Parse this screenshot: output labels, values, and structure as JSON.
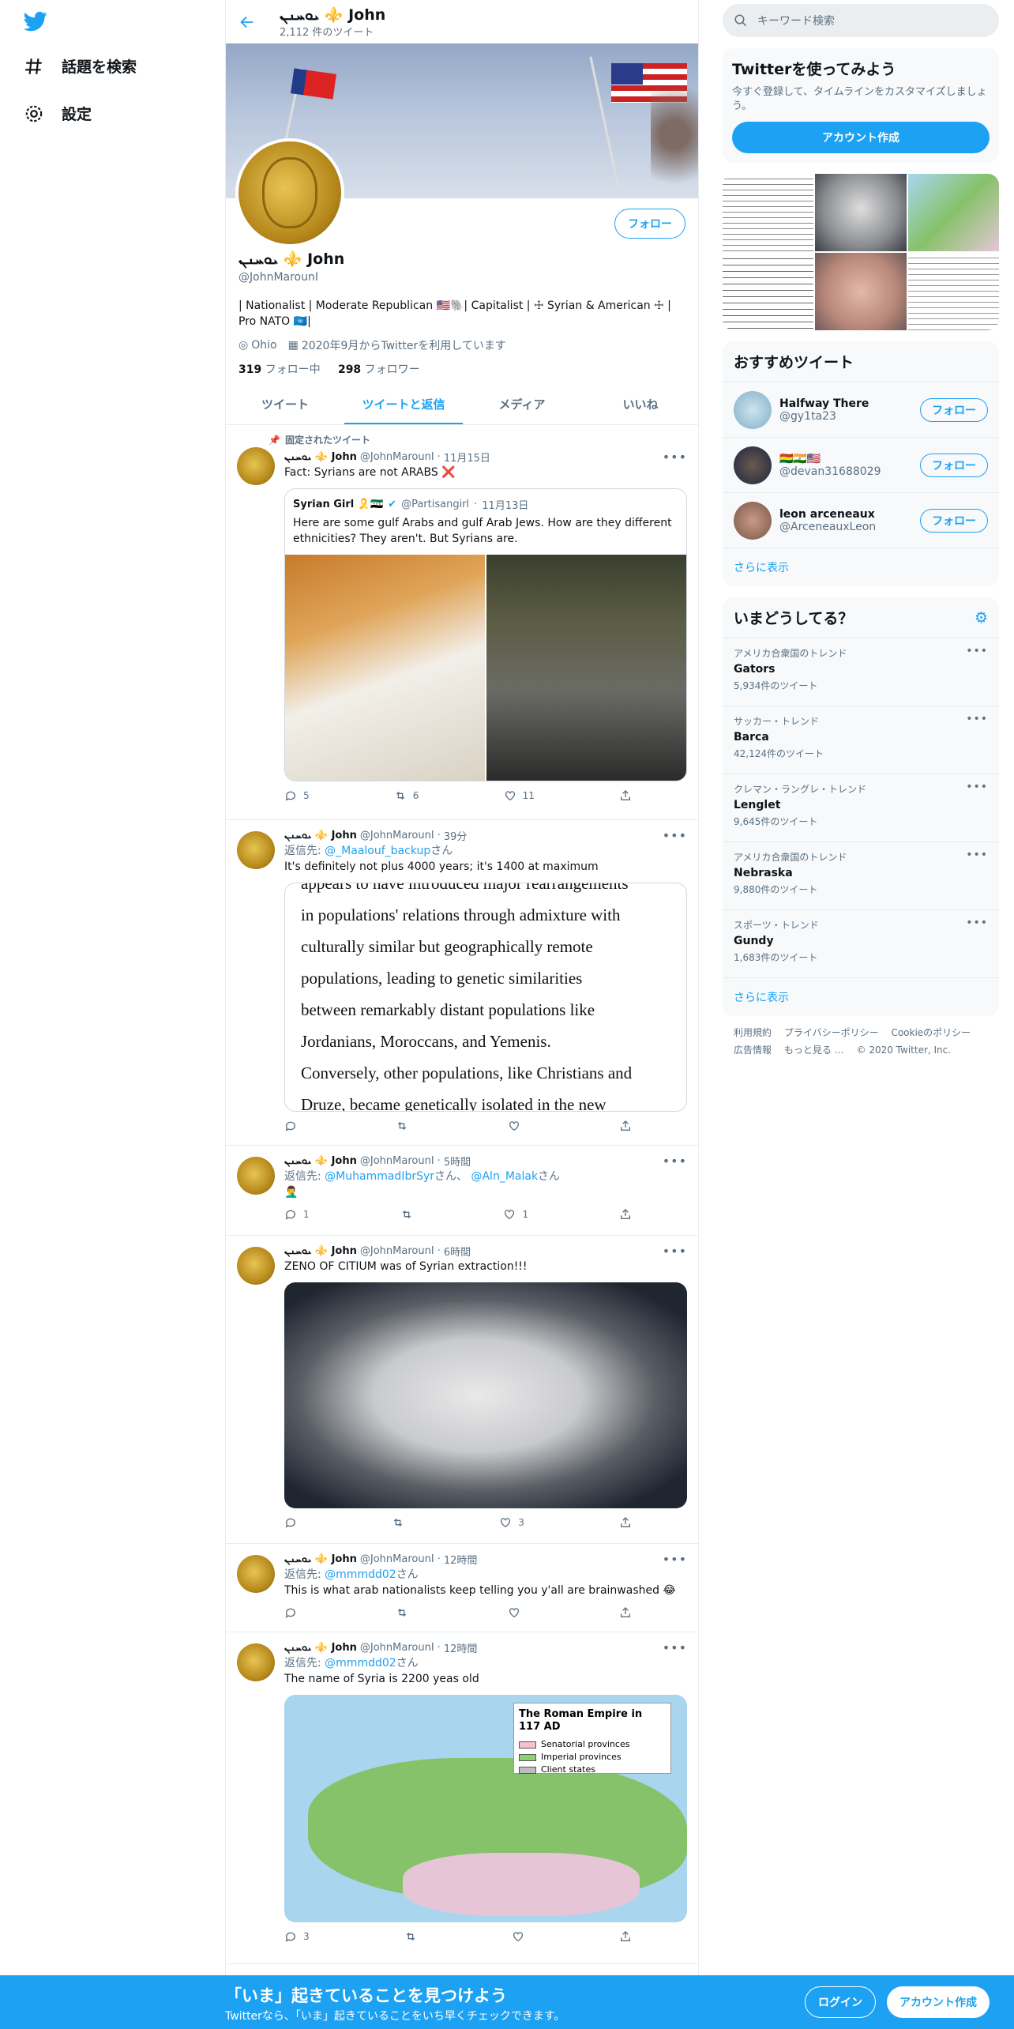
{
  "nav": {
    "explore": "話題を検索",
    "settings": "設定"
  },
  "topbar": {
    "name": "ܝܘܚܢܢ ⚜️ John",
    "tweet_count": "2,112 件のツイート"
  },
  "profile": {
    "name": "ܝܘܚܢܢ ⚜️ John",
    "handle": "@JohnMarounI",
    "bio": "| Nationalist | Moderate Republican 🇺🇸🐘| Capitalist | ☩ Syrian & American ☩ | Pro NATO 🇺🇳|",
    "location": "Ohio",
    "joined": "2020年9月からTwitterを利用しています",
    "following_count": "319",
    "following_label": "フォロー中",
    "followers_count": "298",
    "followers_label": "フォロワー",
    "follow_button": "フォロー"
  },
  "tabs": [
    "ツイート",
    "ツイートと返信",
    "メディア",
    "いいね"
  ],
  "tweets": [
    {
      "pinned": "固定されたツイート",
      "name": "ܝܘܚܢܢ ⚜️ John",
      "handle": "@JohnMarounI",
      "time": "11月15日",
      "text": "Fact: Syrians are not ARABS ❌",
      "quote": {
        "name": "Syrian Girl 🎗️🇸🇾",
        "handle": "@Partisangirl",
        "time": "11月13日",
        "text": "Here are some gulf Arabs and gulf Arab Jews. How are they different ethnicities? They aren't. But Syrians are."
      },
      "replies": "5",
      "retweets": "6",
      "likes": "11"
    },
    {
      "name": "ܝܘܚܢܢ ⚜️ John",
      "handle": "@JohnMarounI",
      "time": "39分",
      "reply_prefix": "返信先:",
      "reply_to": "@_Maalouf_backup",
      "reply_suffix": "さん",
      "text": "It's definitely not plus 4000 years; it's 1400 at maximum",
      "image_text": [
        "appears to have introduced major rearrangements",
        "in populations' relations through admixture with",
        "culturally similar but geographically remote",
        "populations, leading to genetic similarities",
        "between remarkably distant populations like",
        "Jordanians, Moroccans, and Yemenis.",
        "Conversely, other populations, like Christians and",
        "Druze, became genetically isolated in the new"
      ],
      "replies": "",
      "retweets": "",
      "likes": ""
    },
    {
      "name": "ܝܘܚܢܢ ⚜️ John",
      "handle": "@JohnMarounI",
      "time": "5時間",
      "reply_prefix": "返信先:",
      "reply_to": "@MuhammadIbrSyr",
      "reply_suffix": "さん、",
      "reply_to2": "@Aln_Malak",
      "reply_suffix2": "さん",
      "text": "🤦‍♂️",
      "replies": "1",
      "retweets": "",
      "likes": "1"
    },
    {
      "name": "ܝܘܚܢܢ ⚜️ John",
      "handle": "@JohnMarounI",
      "time": "6時間",
      "text": "ZENO OF CITIUM was of Syrian extraction!!!",
      "replies": "",
      "retweets": "",
      "likes": "3"
    },
    {
      "name": "ܝܘܚܢܢ ⚜️ John",
      "handle": "@JohnMarounI",
      "time": "12時間",
      "reply_prefix": "返信先:",
      "reply_to": "@mmmdd02",
      "reply_suffix": "さん",
      "text": "This is what arab nationalists keep telling you y'all are brainwashed 😂",
      "replies": "",
      "retweets": "",
      "likes": ""
    },
    {
      "name": "ܝܘܚܢܢ ⚜️ John",
      "handle": "@JohnMarounI",
      "time": "12時間",
      "reply_prefix": "返信先:",
      "reply_to": "@mmmdd02",
      "reply_suffix": "さん",
      "text": "The name of Syria is 2200 yeas old",
      "map": {
        "title": "The Roman Empire in 117 AD",
        "legend": [
          "Senatorial provinces",
          "Imperial provinces",
          "Client states"
        ],
        "legend_colors": [
          "#f4c2d0",
          "#8cd16e",
          "#bdbdbd"
        ]
      },
      "replies": "3",
      "retweets": "",
      "likes": ""
    }
  ],
  "right": {
    "search_placeholder": "キーワード検索",
    "signup": {
      "title": "Twitterを使ってみよう",
      "text": "今すぐ登録して、タイムラインをカスタマイズしましょう。",
      "button": "アカウント作成"
    },
    "who_title": "おすすめツイート",
    "who": [
      {
        "name": "Halfway There",
        "handle": "@gy1ta23",
        "button": "フォロー"
      },
      {
        "name": "🇧🇴🇮🇳🇺🇸",
        "handle": "@devan31688029",
        "button": "フォロー"
      },
      {
        "name": "leon arceneaux",
        "handle": "@ArceneauxLeon",
        "button": "フォロー"
      }
    ],
    "show_more": "さらに表示",
    "trends_title": "いまどうしてる？",
    "trends": [
      {
        "context": "アメリカ合衆国のトレンド",
        "name": "Gators",
        "count": "5,934件のツイート"
      },
      {
        "context": "サッカー・トレンド",
        "name": "Barca",
        "count": "42,124件のツイート"
      },
      {
        "context": "クレマン・ラングレ・トレンド",
        "name": "Lenglet",
        "count": "9,645件のツイート"
      },
      {
        "context": "アメリカ合衆国のトレンド",
        "name": "Nebraska",
        "count": "9,880件のツイート"
      },
      {
        "context": "スポーツ・トレンド",
        "name": "Gundy",
        "count": "1,683件のツイート"
      }
    ],
    "footer": [
      "利用規約",
      "プライバシーポリシー",
      "Cookieのポリシー",
      "広告情報",
      "もっと見る …",
      "© 2020 Twitter, Inc."
    ]
  },
  "bottombar": {
    "title": "「いま」起きていることを見つけよう",
    "subtitle": "Twitterなら、「いま」起きていることをいち早くチェックできます。",
    "login": "ログイン",
    "signup": "アカウント作成"
  }
}
